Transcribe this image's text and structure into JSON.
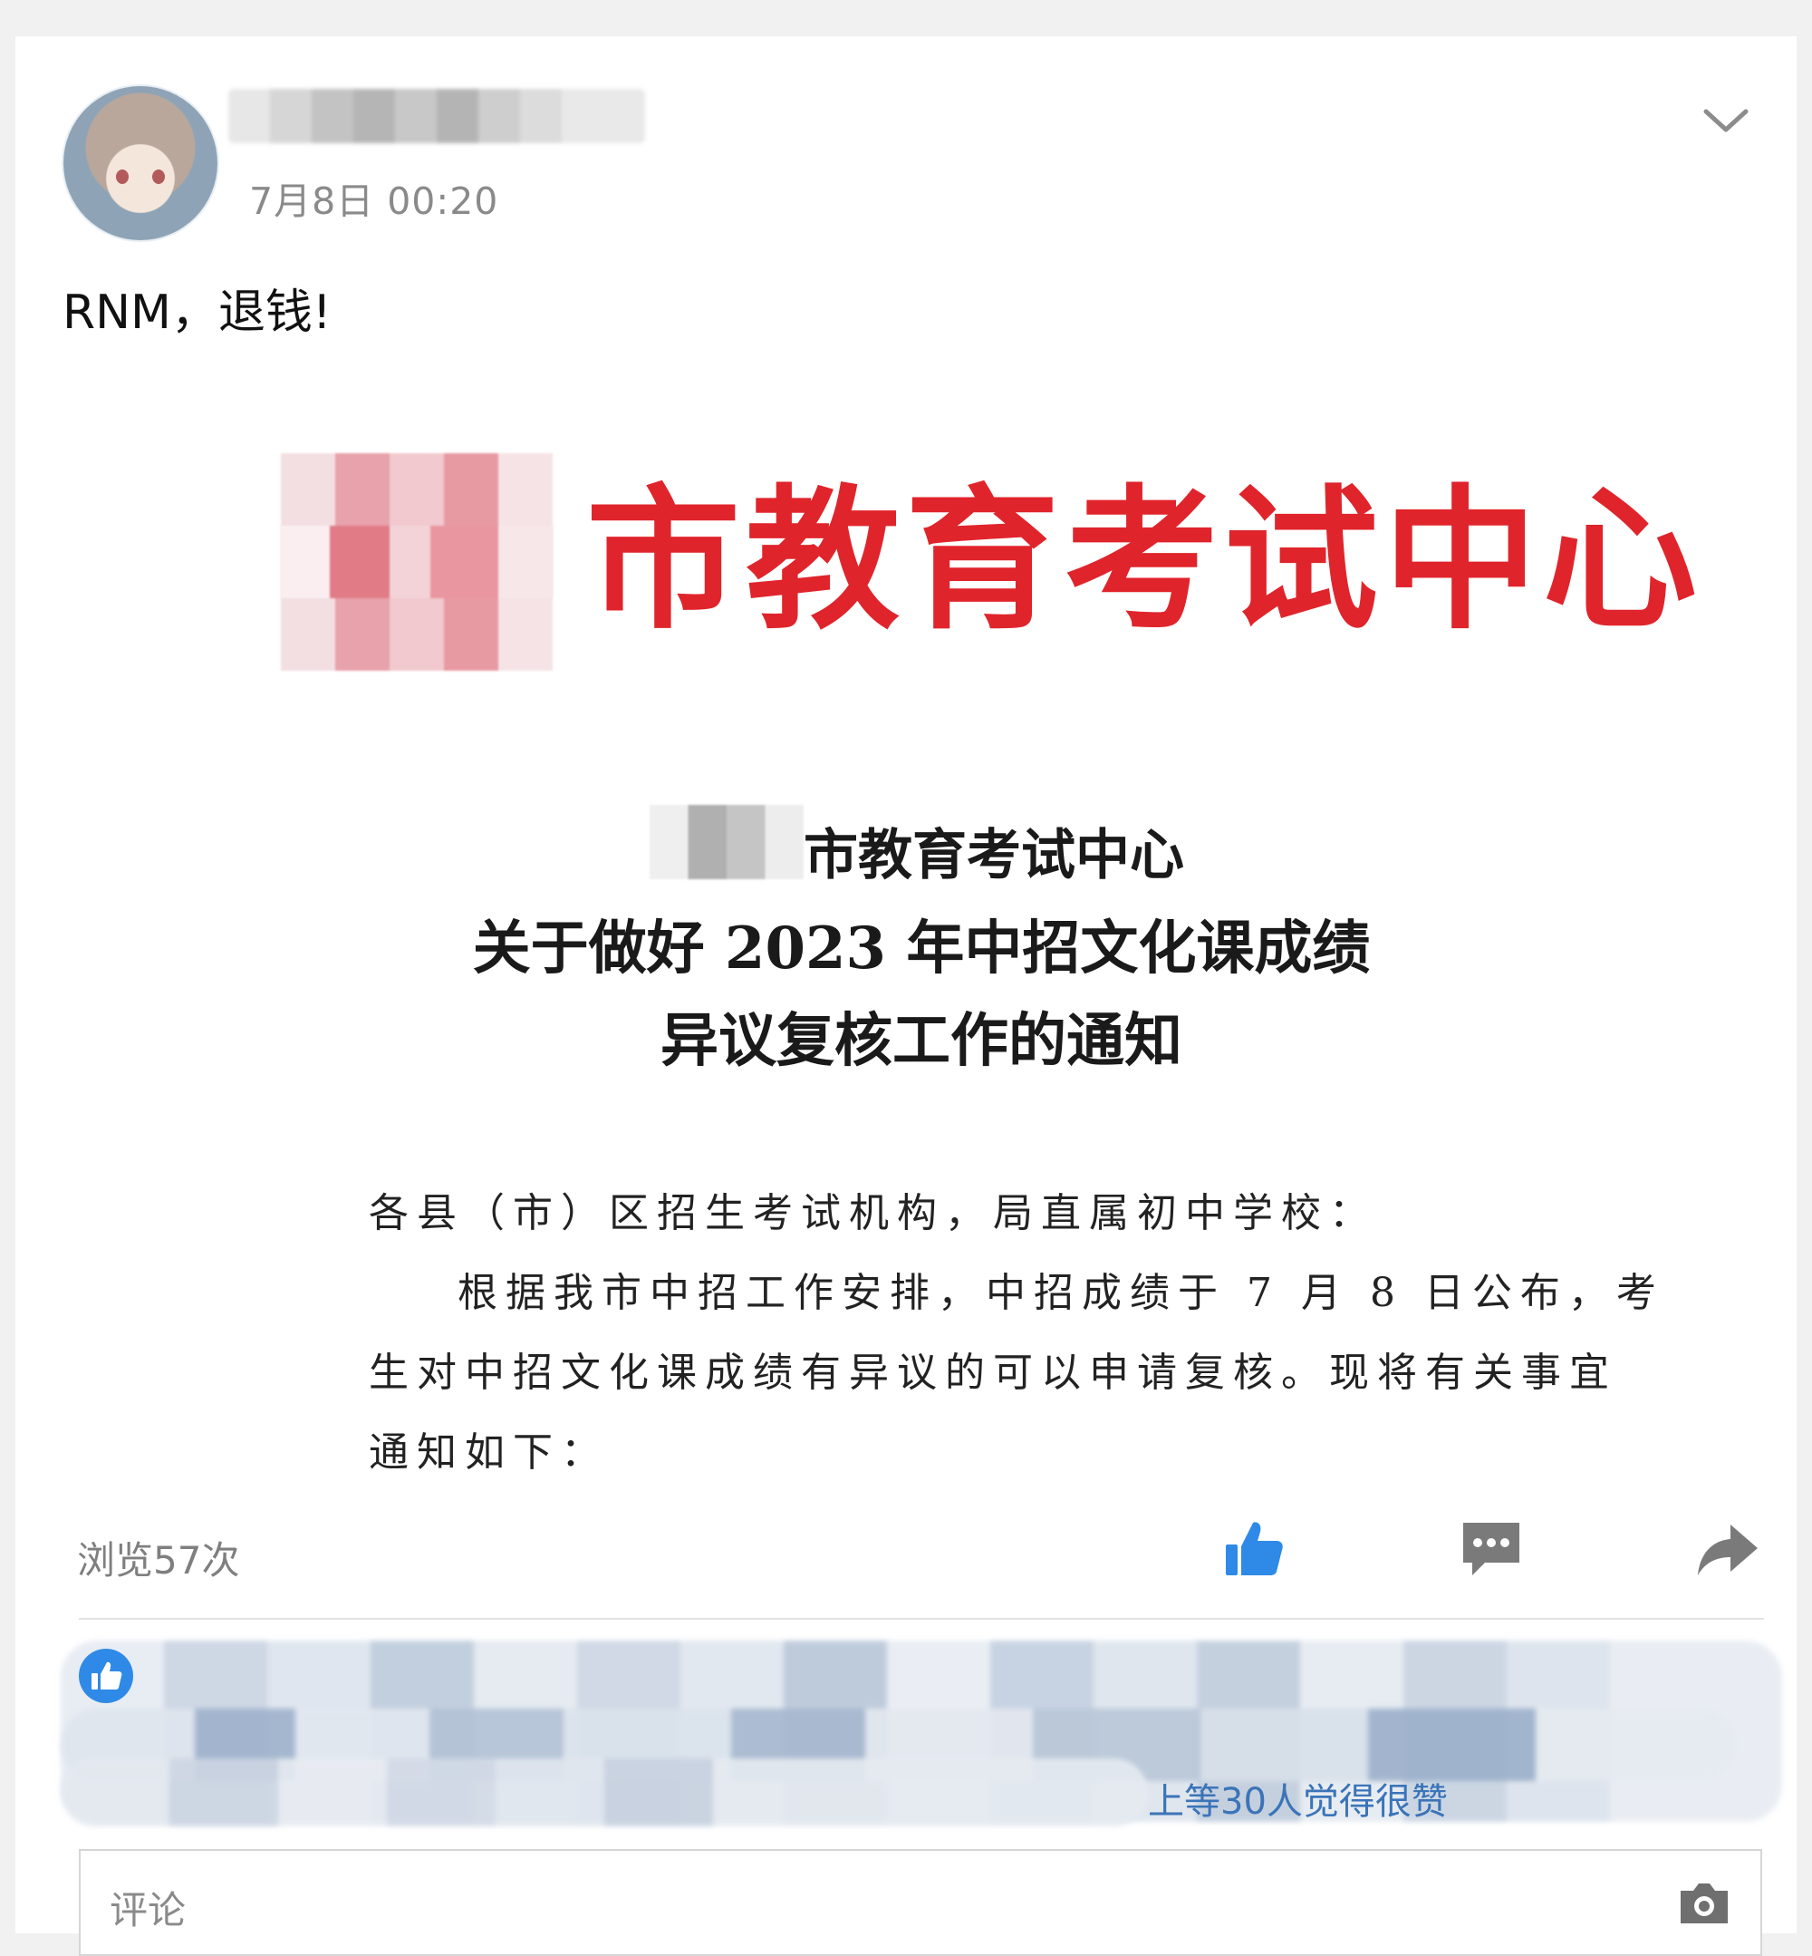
{
  "post": {
    "timestamp": "7月8日 00:20",
    "text": "RNM，退钱!",
    "views": "浏览57次"
  },
  "image_document": {
    "header": "市教育考试中心",
    "title_line1": "市教育考试中心",
    "title_line2": "关于做好 2023 年中招文化课成绩",
    "title_line3": "异议复核工作的通知",
    "body_line1": "各县（市）区招生考试机构，局直属初中学校：",
    "body_line2": "根据我市中招工作安排，中招成绩于 7 月 8 日公布，考",
    "body_line3": "生对中招文化课成绩有异议的可以申请复核。现将有关事宜",
    "body_line4": "通知如下："
  },
  "likes": {
    "summary": "上等30人觉得很赞"
  },
  "comment": {
    "placeholder": "评论"
  },
  "colors": {
    "header_red": "#e0242b",
    "accent_blue": "#2e8ae6",
    "icon_gray": "#7a7a7a"
  },
  "icons": {
    "dropdown": "chevron-down-icon",
    "like": "thumbs-up-icon",
    "comment": "comment-icon",
    "share": "share-icon",
    "likes_badge": "thumbs-up-badge-icon",
    "camera": "camera-icon"
  }
}
